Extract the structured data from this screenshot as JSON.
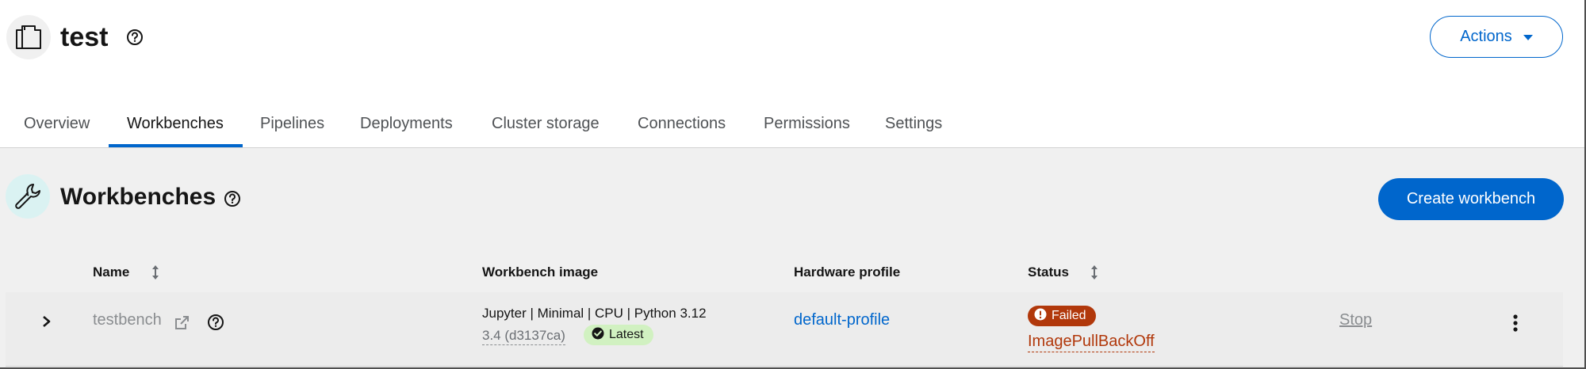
{
  "header": {
    "project_icon": "briefcase-icon",
    "title": "test",
    "help_icon": "question-circle-icon",
    "actions_label": "Actions"
  },
  "tabs": [
    {
      "label": "Overview",
      "active": false
    },
    {
      "label": "Workbenches",
      "active": true
    },
    {
      "label": "Pipelines",
      "active": false
    },
    {
      "label": "Deployments",
      "active": false
    },
    {
      "label": "Cluster storage",
      "active": false
    },
    {
      "label": "Connections",
      "active": false
    },
    {
      "label": "Permissions",
      "active": false
    },
    {
      "label": "Settings",
      "active": false
    }
  ],
  "section": {
    "icon": "wrench-icon",
    "title": "Workbenches",
    "create_label": "Create workbench"
  },
  "table": {
    "columns": {
      "name": "Name",
      "image": "Workbench image",
      "hardware": "Hardware profile",
      "status": "Status"
    },
    "rows": [
      {
        "name": "testbench",
        "image_name": "Jupyter | Minimal | CPU | Python 3.12",
        "image_version": "3.4 (d3137ca)",
        "image_badge": "Latest",
        "hardware_profile": "default-profile",
        "status_badge": "Failed",
        "status_reason": "ImagePullBackOff",
        "action_label": "Stop"
      }
    ]
  },
  "colors": {
    "primary": "#0066cc",
    "danger": "#b1380b",
    "success_bg": "#d1f1c1",
    "section_icon_bg": "#daf2f2"
  }
}
